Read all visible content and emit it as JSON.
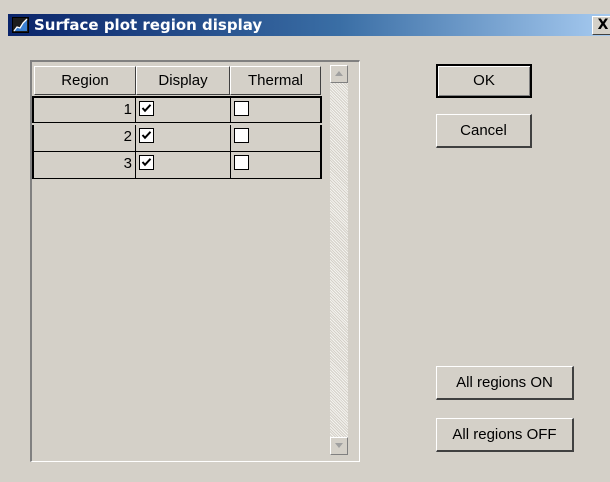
{
  "window": {
    "title": "Surface plot region display",
    "close_label": "X"
  },
  "grid": {
    "headers": {
      "region": "Region",
      "display": "Display",
      "thermal": "Thermal"
    },
    "rows": [
      {
        "region": "1",
        "display": true,
        "thermal": false
      },
      {
        "region": "2",
        "display": true,
        "thermal": false
      },
      {
        "region": "3",
        "display": true,
        "thermal": false
      }
    ]
  },
  "buttons": {
    "ok": "OK",
    "cancel": "Cancel",
    "all_on": "All regions ON",
    "all_off": "All regions OFF"
  },
  "colors": {
    "dialog_bg": "#d4d0c8",
    "titlebar_start": "#0a246a",
    "titlebar_end": "#a6caf0"
  }
}
